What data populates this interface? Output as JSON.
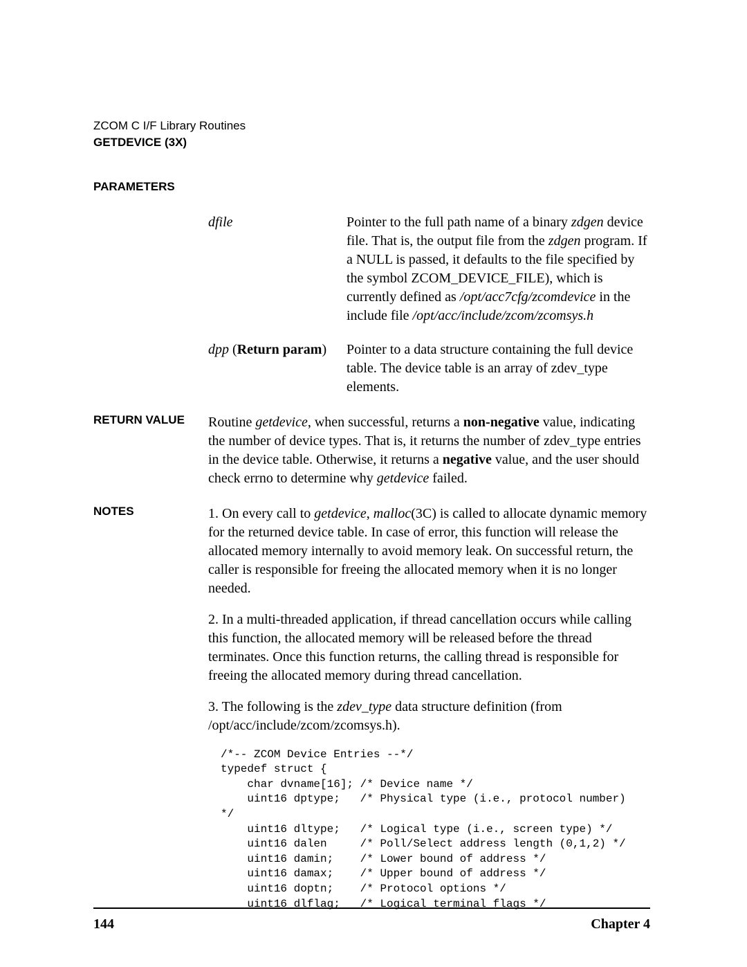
{
  "header": {
    "line1": "ZCOM C I/F Library Routines",
    "line2": "GETDEVICE (3X)"
  },
  "sections": {
    "parameters_label": "PARAMETERS",
    "return_label": "RETURN VALUE",
    "notes_label": "NOTES"
  },
  "params": {
    "dfile": {
      "name": "dfile",
      "desc_pre": "Pointer to the full path name of a binary ",
      "desc_ital1": "zdgen",
      "desc_mid1": " device file. That is, the output file from the ",
      "desc_ital2": "zdgen",
      "desc_mid2": " program. If a NULL is passed, it defaults to the file specified by the symbol ZCOM_DEVICE_FILE), which is currently defined as ",
      "desc_ital3": "/opt/acc7cfg/zcomdevice",
      "desc_mid3": " in the include file ",
      "desc_ital4": "/opt/acc/include/zcom/zcomsys.h"
    },
    "dpp": {
      "name_ital": "dpp",
      "name_rest_open": " (",
      "name_rest_bold": "Return param",
      "name_rest_close": ")",
      "desc": "Pointer to a data structure containing the full device table. The device table is an array of zdev_type elements."
    }
  },
  "return_value": {
    "t1": "Routine ",
    "ital1": "getdevice",
    "t2": ", when successful, returns a ",
    "bold1": "non-negative",
    "t3": " value, indicating the number of device types. That is, it returns the number of zdev_type entries in the device table. Otherwise, it returns a ",
    "bold2": "negative",
    "t4": " value, and the user should check errno to determine why ",
    "ital2": "getdevice",
    "t5": " failed."
  },
  "notes": {
    "n1_a": "1. On every call to ",
    "n1_ital1": "getdevice",
    "n1_b": ", ",
    "n1_ital2": "malloc",
    "n1_c": "(3C) is called to allocate dynamic memory for the returned device table. In case of error, this function will release the allocated memory internally to avoid memory leak. On successful return, the caller is responsible for freeing the allocated memory when it is no longer needed.",
    "n2": "2. In a multi-threaded application, if thread cancellation occurs while calling this function, the allocated memory will be released before the thread terminates. Once this function returns, the calling thread is responsible for freeing the allocated memory during thread cancellation.",
    "n3_a": "3. The following is the ",
    "n3_ital": "zdev_type",
    "n3_b": " data structure definition (from /opt/acc/include/zcom/zcomsys.h).",
    "code": "/*-- ZCOM Device Entries --*/\ntypedef struct {\n    char dvname[16]; /* Device name */\n    uint16 dptype;   /* Physical type (i.e., protocol number)\n*/\n    uint16 dltype;   /* Logical type (i.e., screen type) */\n    uint16 dalen     /* Poll/Select address length (0,1,2) */\n    uint16 damin;    /* Lower bound of address */\n    uint16 damax;    /* Upper bound of address */\n    uint16 doptn;    /* Protocol options */\n    uint16 dlflag;   /* Logical terminal flags */"
  },
  "footer": {
    "page": "144",
    "chapter": "Chapter 4"
  }
}
